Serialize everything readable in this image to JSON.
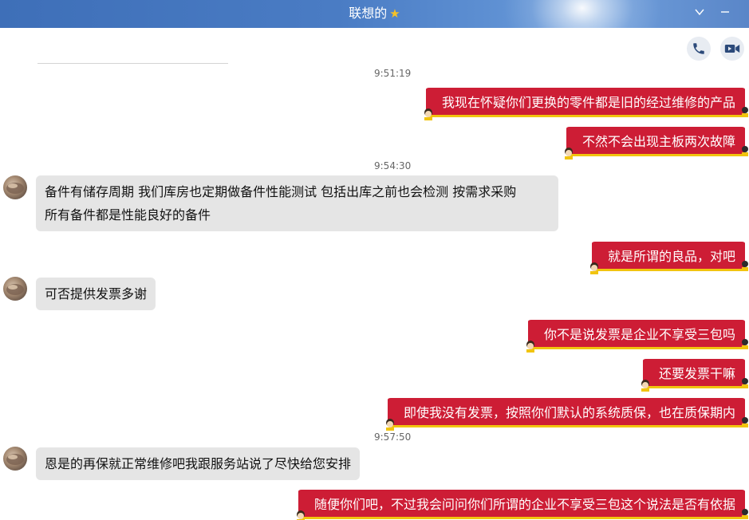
{
  "window": {
    "title": "联想的",
    "title_star": "★",
    "controls": {
      "collapse": "∨",
      "minimize": "—"
    }
  },
  "colors": {
    "titlebar": "#4a7cc4",
    "outgoing_bubble": "#cd1d35",
    "incoming_bubble": "#e5e5e5"
  },
  "icons": {
    "voice_call": "phone-icon",
    "video_call": "video-icon"
  },
  "messages": [
    {
      "type": "timestamp",
      "text": "9:51:19"
    },
    {
      "type": "out",
      "text": "我现在怀疑你们更换的零件都是旧的经过维修的产品"
    },
    {
      "type": "out",
      "text": "不然不会出现主板两次故障"
    },
    {
      "type": "timestamp",
      "text": "9:54:30"
    },
    {
      "type": "in",
      "line1": "备件有储存周期 我们库房也定期做备件性能测试 包括出库之前也会检测 按需求采购",
      "line2": "所有备件都是性能良好的备件"
    },
    {
      "type": "out",
      "text": "就是所谓的良品，对吧"
    },
    {
      "type": "in",
      "text": "可否提供发票多谢"
    },
    {
      "type": "out",
      "text": "你不是说发票是企业不享受三包吗"
    },
    {
      "type": "out",
      "text": "还要发票干嘛"
    },
    {
      "type": "out",
      "text": "即使我没有发票，按照你们默认的系统质保，也在质保期内"
    },
    {
      "type": "timestamp",
      "text": "9:57:50"
    },
    {
      "type": "in",
      "text": "恩是的再保就正常维修吧我跟服务站说了尽快给您安排"
    },
    {
      "type": "out",
      "text": "随便你们吧，不过我会问问你们所谓的企业不享受三包这个说法是否有依据"
    }
  ]
}
